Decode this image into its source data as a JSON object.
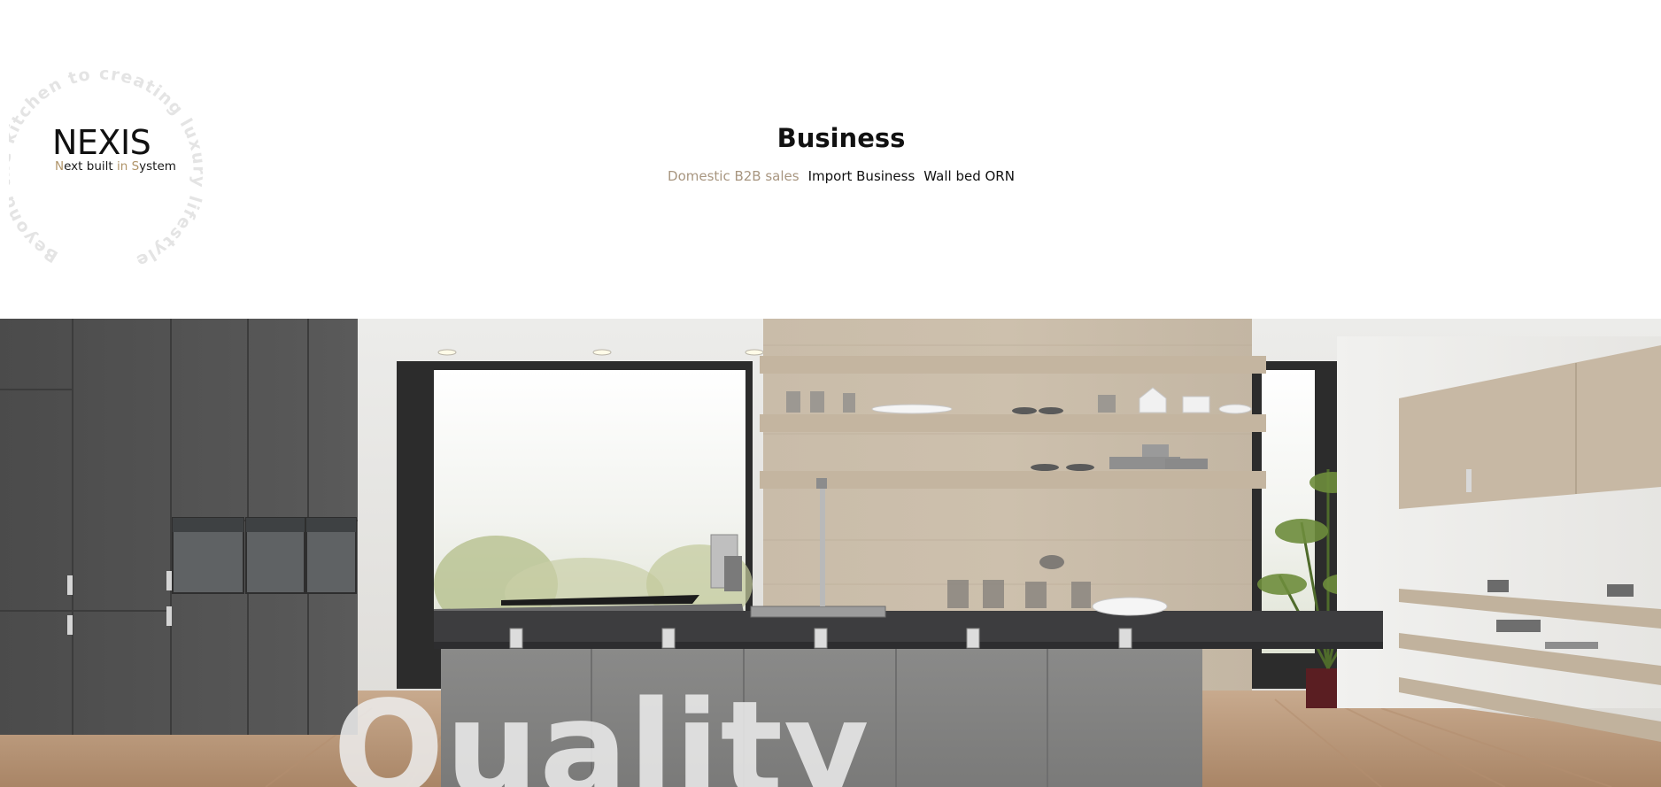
{
  "brand": {
    "name": "NEXIS",
    "tagline_parts": [
      "N",
      "ext built ",
      "in",
      " ",
      "S",
      "ystem"
    ],
    "ring_text": "Beyond the kitchen to creating luxury lifestyle and life",
    "accent_color": "#b09468"
  },
  "page": {
    "title": "Business"
  },
  "subnav": {
    "items": [
      {
        "label": "Domestic B2B sales",
        "active": true
      },
      {
        "label": "Import Business",
        "active": false
      },
      {
        "label": "Wall bed ORN",
        "active": false
      }
    ],
    "active_color": "#a89680"
  },
  "hero": {
    "overlay_text": "Quality",
    "image_alt": "modern kitchen with grey cabinets, island and wooden shelving"
  }
}
